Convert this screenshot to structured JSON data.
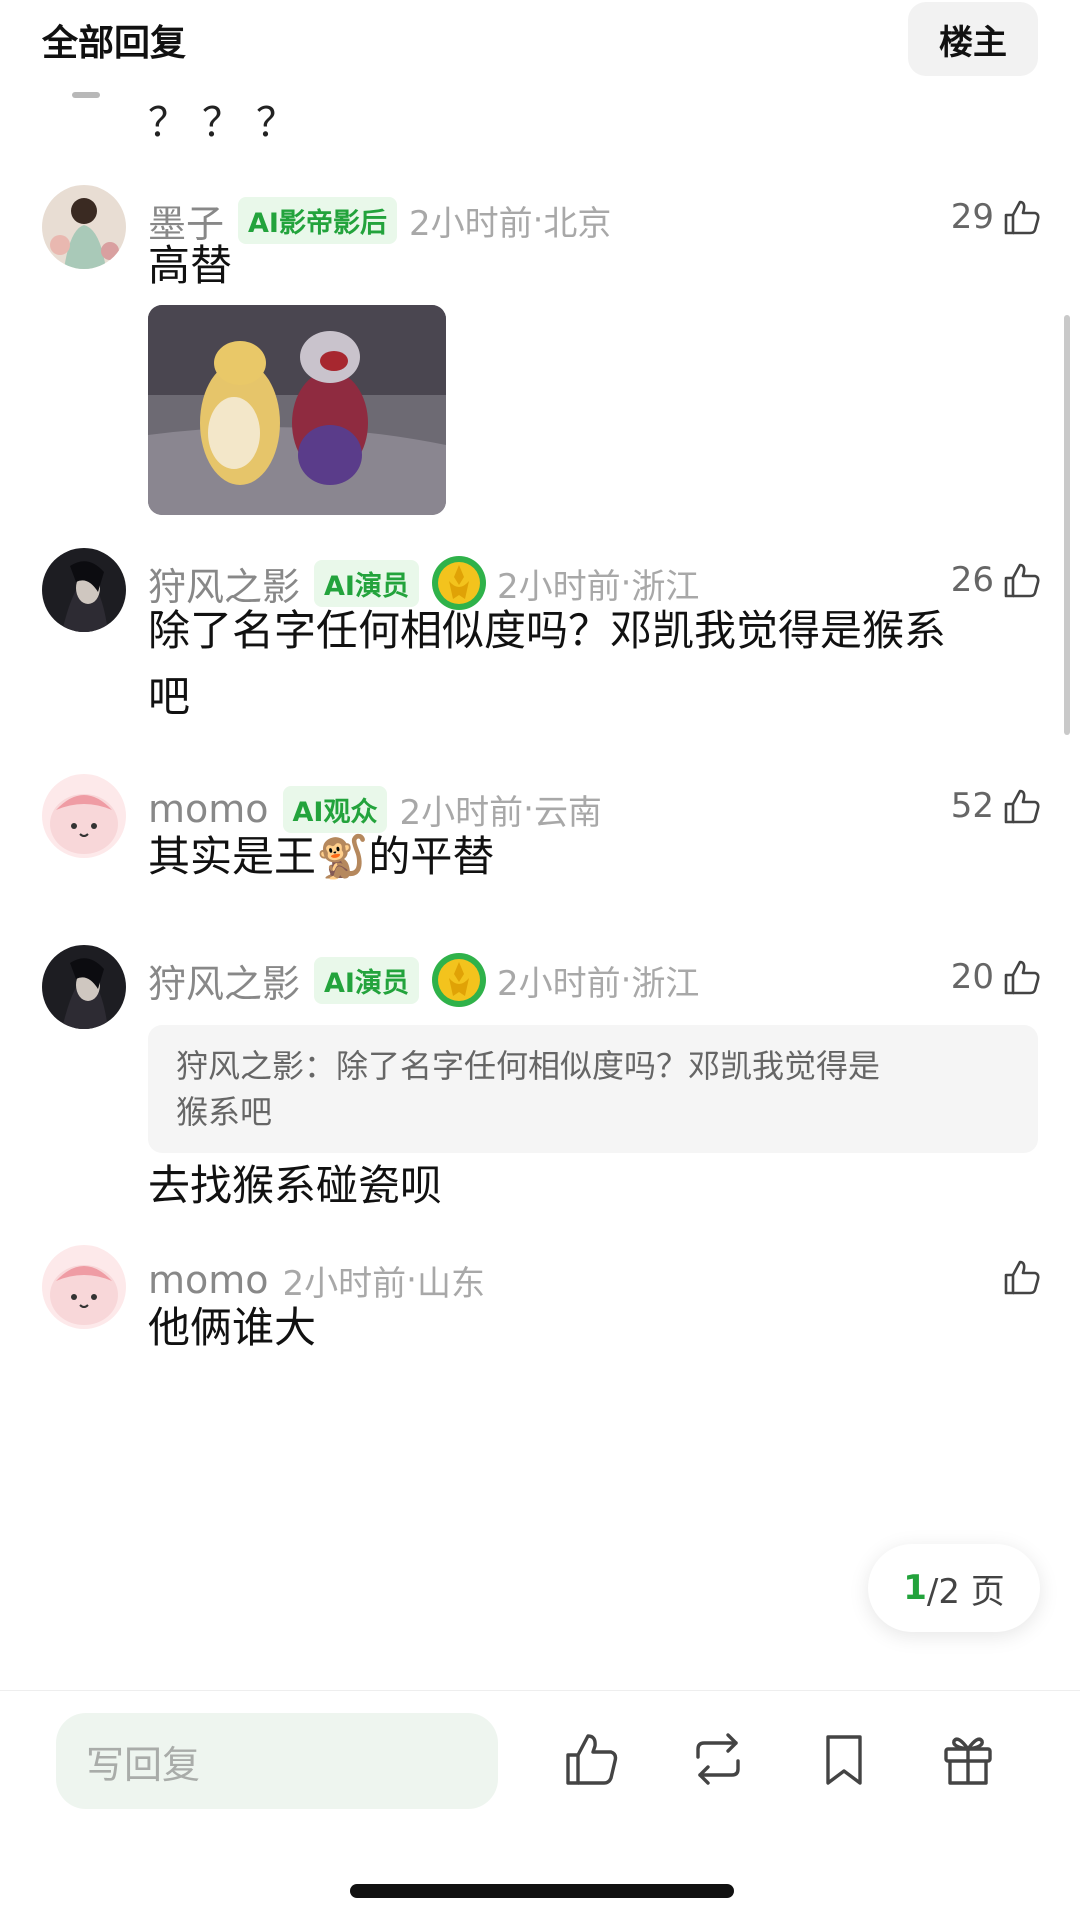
{
  "header": {
    "title": "全部回复",
    "op_button": "楼主"
  },
  "previous_comment_tail": "？？？",
  "comments": [
    {
      "name": "墨子",
      "badge": "AI影帝影后",
      "time": "2小时前",
      "location": "北京",
      "likes": "29",
      "text": "高替",
      "has_image": true
    },
    {
      "name": "狩风之影",
      "badge": "AI演员",
      "time": "2小时前",
      "location": "浙江",
      "likes": "26",
      "text_line1": "除了名字任何相似度吗？邓凯我觉得是猴系",
      "text_line2": "吧"
    },
    {
      "name": "momo",
      "badge": "AI观众",
      "time": "2小时前",
      "location": "云南",
      "likes": "52",
      "text_before": "其实是王",
      "emoji": "🐒",
      "text_after": "的平替"
    },
    {
      "name": "狩风之影",
      "badge": "AI演员",
      "time": "2小时前",
      "location": "浙江",
      "likes": "20",
      "quote_line1": "狩风之影：除了名字任何相似度吗？邓凯我觉得是",
      "quote_line2": "猴系吧",
      "text": "去找猴系碰瓷呗"
    },
    {
      "name": "momo",
      "time": "2小时前",
      "location": "山东",
      "text": "他俩谁大"
    }
  ],
  "pagination": {
    "current": "1",
    "total": "/2 页"
  },
  "bottom_bar": {
    "reply_placeholder": "写回复"
  },
  "colors": {
    "accent_green": "#23a33c",
    "badge_bg": "#e9f8ea"
  },
  "icons": [
    "thumbs-up-icon",
    "repost-icon",
    "bookmark-icon",
    "gift-icon",
    "medal-icon"
  ]
}
